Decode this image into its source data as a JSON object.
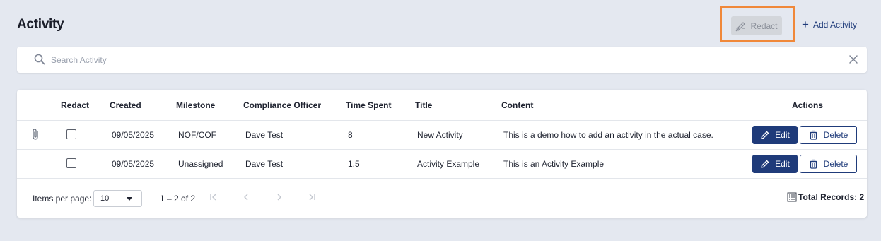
{
  "page": {
    "title": "Activity"
  },
  "toolbar": {
    "redact_label": "Redact",
    "add_activity_label": "Add Activity"
  },
  "search": {
    "placeholder": "Search Activity",
    "value": ""
  },
  "table": {
    "columns": [
      "Redact",
      "Created",
      "Milestone",
      "Compliance Officer",
      "Time Spent",
      "Title",
      "Content",
      "Actions"
    ],
    "rows": [
      {
        "has_attachment": true,
        "redact_checked": false,
        "created": "09/05/2025",
        "milestone": "NOF/COF",
        "compliance_officer": "Dave Test",
        "time_spent": "8",
        "title": "New Activity",
        "content": "This is a demo how to add an activity in the actual case."
      },
      {
        "has_attachment": false,
        "redact_checked": false,
        "created": "09/05/2025",
        "milestone": "Unassigned",
        "compliance_officer": "Dave Test",
        "time_spent": "1.5",
        "title": "Activity Example",
        "content": "This is an Activity Example"
      }
    ],
    "edit_label": "Edit",
    "delete_label": "Delete"
  },
  "pagination": {
    "items_per_page_label": "Items per page:",
    "page_size": "10",
    "range_label": "1 – 2 of 2",
    "total_records_label": "Total Records: 2"
  },
  "colors": {
    "primary": "#1f3b7a",
    "highlight": "#f0883a",
    "background": "#e4e8f0"
  },
  "icons": [
    "redact-icon",
    "plus-icon",
    "search-icon",
    "close-icon",
    "paperclip-icon",
    "pencil-icon",
    "trash-icon",
    "first-page-icon",
    "prev-page-icon",
    "next-page-icon",
    "last-page-icon",
    "list-icon",
    "chevron-down-icon"
  ]
}
